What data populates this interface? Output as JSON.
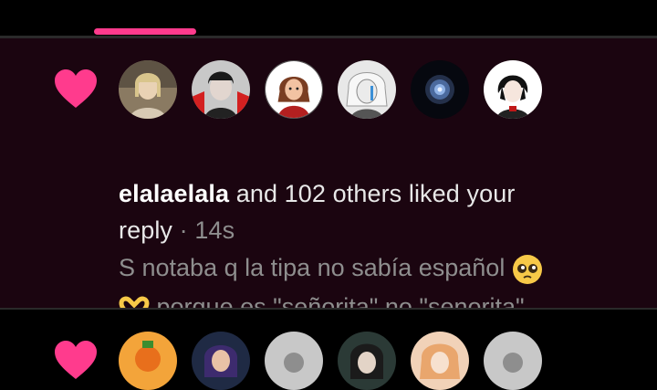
{
  "header": {
    "active_tab_color": "#ff3b8d"
  },
  "notification": {
    "type": "like",
    "icon": "heart-icon",
    "user": "elalaelala",
    "action_text": "and 102 others liked your",
    "object_text": "reply",
    "separator": "·",
    "time_ago": "14s",
    "comment_line1": "S notaba q la tipa no sabía español",
    "emoji_1": "pleading-face",
    "emoji_2": "heart-hands",
    "comment_line2": "porque es \"señorita\" no \"senorita\"",
    "likers_shown": 6,
    "accent_color": "#ff3b8d",
    "background_color": "#1b0510"
  },
  "next_notification": {
    "icon": "heart-icon",
    "likers_shown": 6
  }
}
